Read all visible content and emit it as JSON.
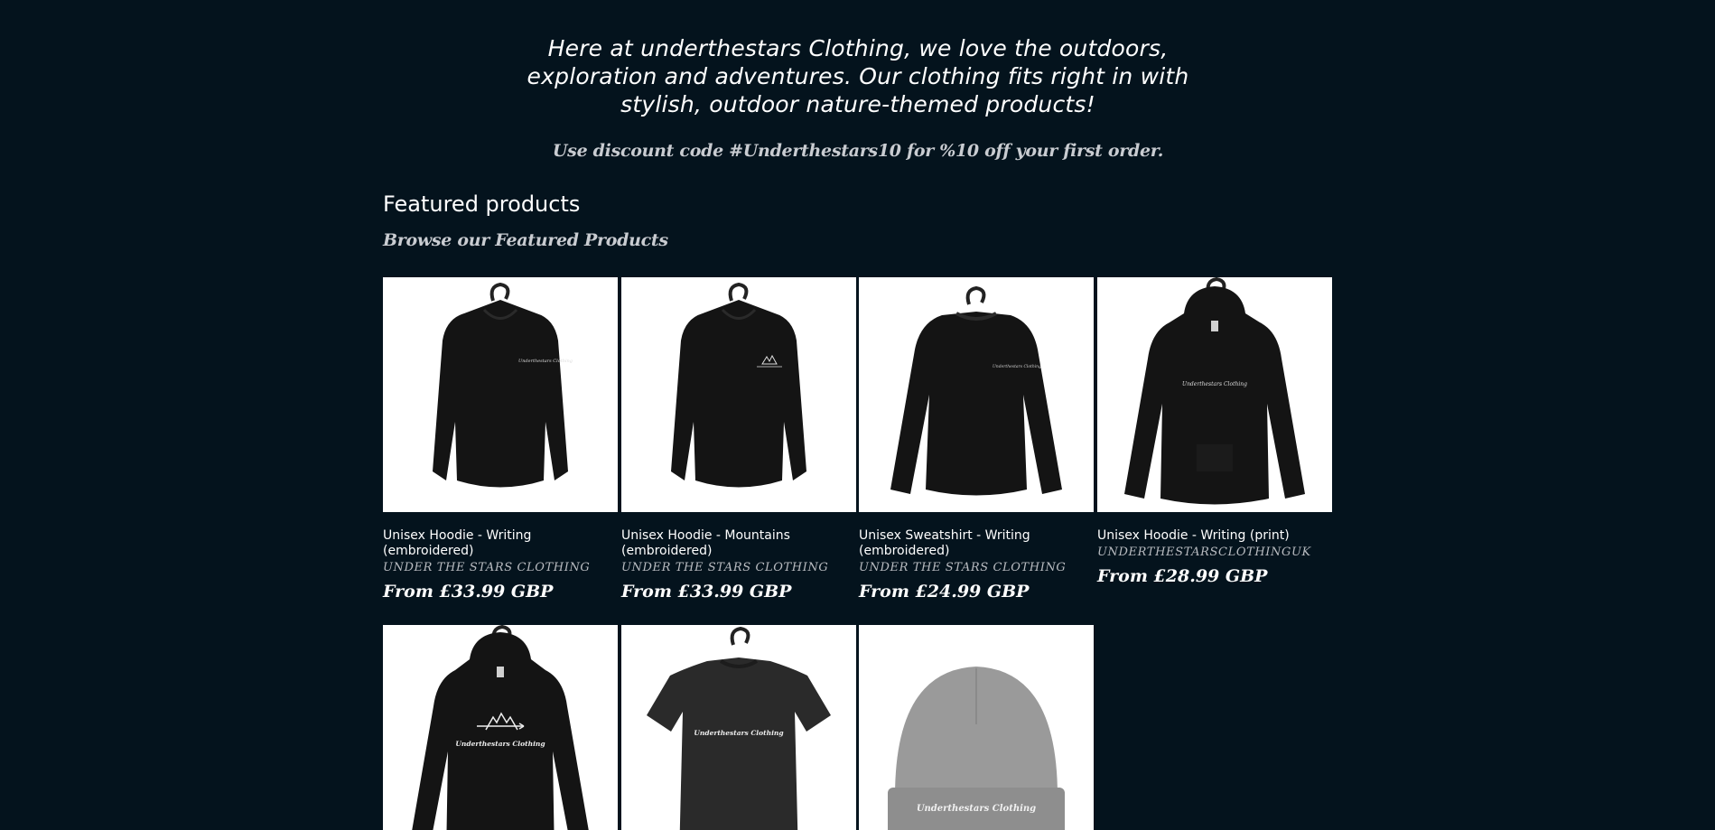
{
  "intro": {
    "text": "Here at underthestars Clothing, we love the outdoors, exploration and adventures. Our clothing fits right in with stylish, outdoor nature-themed products!",
    "discount": "Use discount code #Underthestars10 for %10 off your first order."
  },
  "featured": {
    "title": "Featured products",
    "subtitle": "Browse our Featured Products"
  },
  "products": [
    {
      "title": "Unisex Hoodie - Writing (embroidered)",
      "vendor": "UNDER THE STARS CLOTHING",
      "price": "From £33.99 GBP",
      "image_icon": "hoodie-icon",
      "print_text": "Underthestars Clothing"
    },
    {
      "title": "Unisex Hoodie - Mountains (embroidered)",
      "vendor": "UNDER THE STARS CLOTHING",
      "price": "From £33.99 GBP",
      "image_icon": "hoodie-icon",
      "print_text": ""
    },
    {
      "title": "Unisex Sweatshirt - Writing (embroidered)",
      "vendor": "UNDER THE STARS CLOTHING",
      "price": "From £24.99 GBP",
      "image_icon": "sweatshirt-icon",
      "print_text": "Underthestars Clothing"
    },
    {
      "title": "Unisex Hoodie - Writing (print)",
      "vendor": "UNDERTHESTARSCLOTHINGUK",
      "price": "From £28.99 GBP",
      "image_icon": "hoodie-icon",
      "print_text": "Underthestars Clothing"
    },
    {
      "title": "",
      "vendor": "",
      "price": "",
      "image_icon": "hoodie-icon",
      "print_text": "Underthestars Clothing"
    },
    {
      "title": "",
      "vendor": "",
      "price": "",
      "image_icon": "tshirt-icon",
      "print_text": "Underthestars Clothing"
    },
    {
      "title": "",
      "vendor": "",
      "price": "",
      "image_icon": "beanie-icon",
      "print_text": "Underthestars Clothing"
    }
  ],
  "colors": {
    "background": "#04131d",
    "garment_black": "#141414",
    "beanie_grey": "#8e8e8e"
  }
}
